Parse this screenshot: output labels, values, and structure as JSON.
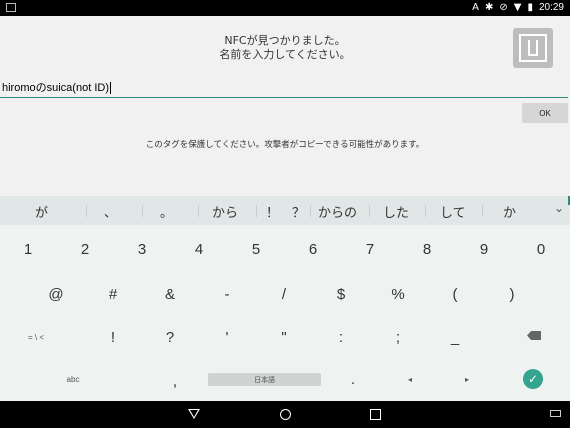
{
  "status": {
    "time": "20:29",
    "icons": [
      "a-icon",
      "bluetooth-icon",
      "blocked-icon",
      "wifi-icon",
      "battery-icon"
    ]
  },
  "dialog": {
    "title_line1": "NFCが見つかりました。",
    "title_line2": "名前を入力してください。",
    "input_value": "hiromoのsuica(not ID)",
    "ok_label": "OK",
    "warning": "このタグを保護してください。攻撃者がコピーできる可能性があります。"
  },
  "suggestions": [
    "が",
    "、",
    "。",
    "から",
    "！",
    "？",
    "からの",
    "した",
    "して",
    "か"
  ],
  "keyboard": {
    "row1": [
      "1",
      "2",
      "3",
      "4",
      "5",
      "6",
      "7",
      "8",
      "9",
      "0"
    ],
    "row2": [
      "@",
      "#",
      "&",
      "-",
      "/",
      "$",
      "%",
      "(",
      ")"
    ],
    "row3_left": "= \\ <",
    "row3": [
      "!",
      "?",
      "'",
      "\"",
      ":",
      ";",
      "_"
    ],
    "abc": "abc",
    "comma": ",",
    "space_label": "日本語",
    "period": ".",
    "left_arrow": "◂",
    "right_arrow": "▸",
    "enter_symbol": "✓"
  }
}
